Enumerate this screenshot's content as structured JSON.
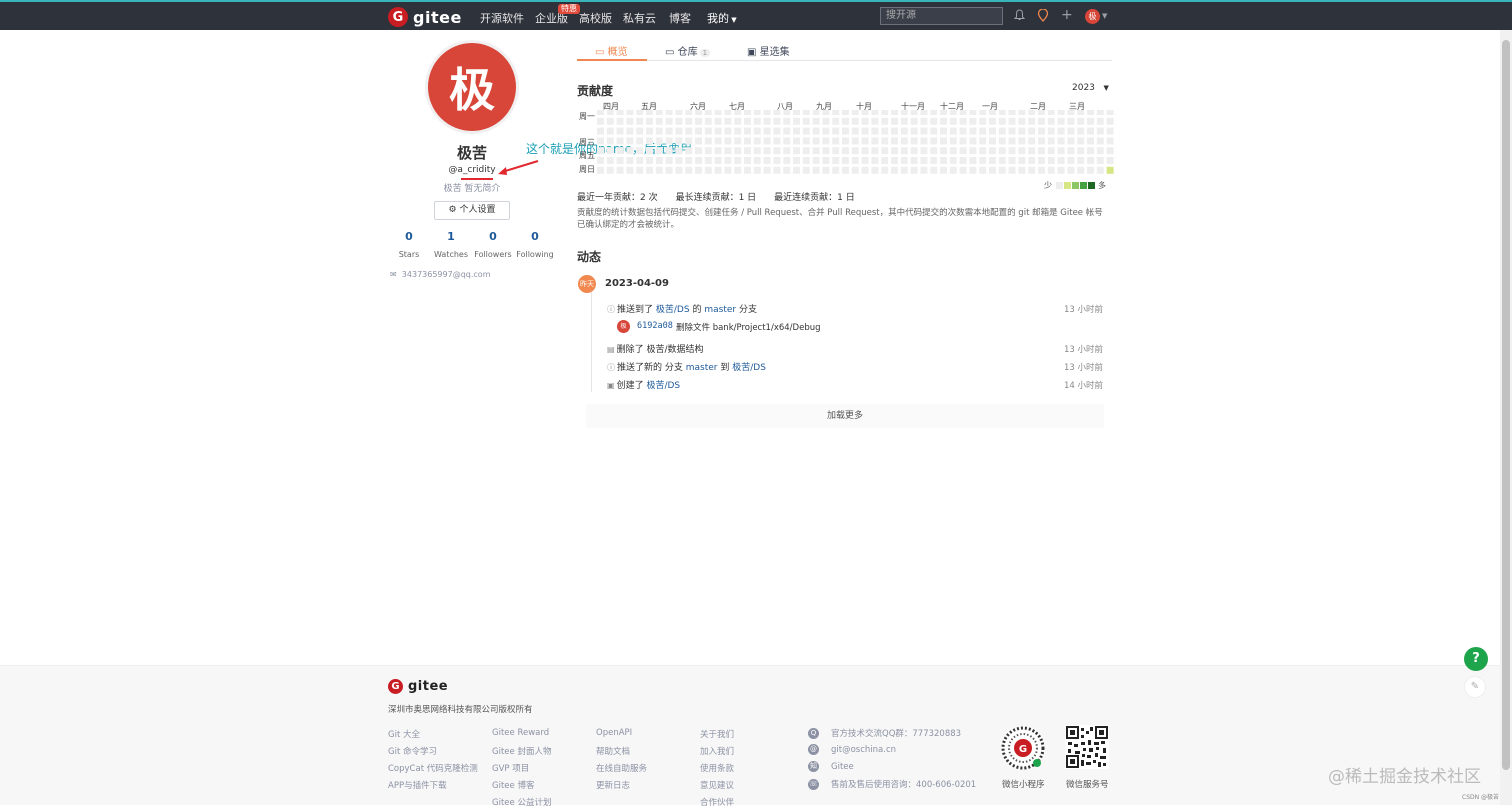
{
  "nav": {
    "brand": "gitee",
    "items": [
      "开源软件",
      "企业版",
      "高校版",
      "私有云",
      "博客",
      "我的"
    ],
    "badge": "特惠",
    "search_placeholder": "搜开源",
    "avatar_char": "极",
    "accent_color": "#37b5b9"
  },
  "profile": {
    "avatar_char": "极",
    "name": "极苦",
    "username": "@a_cridity",
    "bio": "极苦 暂无简介",
    "settings_label": "个人设置",
    "stats": [
      {
        "value": "0",
        "label": "Stars"
      },
      {
        "value": "1",
        "label": "Watches"
      },
      {
        "value": "0",
        "label": "Followers"
      },
      {
        "value": "0",
        "label": "Following"
      }
    ],
    "email": "3437365997@qq.com"
  },
  "annotation": "这个就是你的name，后面要用",
  "tabs": [
    {
      "label": "概览",
      "active": true
    },
    {
      "label": "仓库",
      "count": "1"
    },
    {
      "label": "星选集"
    }
  ],
  "contribution": {
    "title": "贡献度",
    "year": "2023",
    "months": [
      "四月",
      "五月",
      "六月",
      "七月",
      "八月",
      "九月",
      "十月",
      "十一月",
      "十二月",
      "一月",
      "二月",
      "三月"
    ],
    "days": [
      "周一",
      "周三",
      "周五",
      "周日"
    ],
    "legend_less": "少",
    "legend_more": "多",
    "stats": "最近一年贡献：2 次　　最长连续贡献：1 日　　最近连续贡献：1 日",
    "description": "贡献度的统计数据包括代码提交、创建任务 / Pull Request、合并 Pull Request，其中代码提交的次数需本地配置的 git 邮箱是 Gitee 帐号已确认绑定的才会被统计。",
    "level_colors": [
      "#eeeeee",
      "#d6e685",
      "#8cc665",
      "#44a340",
      "#1e6823"
    ]
  },
  "activity": {
    "title": "动态",
    "day_badge": "昨天",
    "date": "2023-04-09",
    "events": [
      {
        "icon": "push-icon",
        "pre": "推送到了",
        "link1": "极苦/DS",
        "mid": "的",
        "link2": "master",
        "post": "分支",
        "time": "13 小时前"
      },
      {
        "icon": "delete-icon",
        "pre": "删除了",
        "link1": "",
        "mid": "极苦/数据结构",
        "link2": "",
        "post": "",
        "time": "13 小时前"
      },
      {
        "icon": "push-icon",
        "pre": "推送了新的 分支",
        "link1": "master",
        "mid": "到",
        "link2": "极苦/DS",
        "post": "",
        "time": "13 小时前"
      },
      {
        "icon": "create-icon",
        "pre": "创建了",
        "link1": "极苦/DS",
        "mid": "",
        "link2": "",
        "post": "",
        "time": "14 小时前"
      }
    ],
    "commit": {
      "avatar_char": "极",
      "hash": "6192a08",
      "message": "删除文件 bank/Project1/x64/Debug"
    },
    "load_more": "加载更多"
  },
  "footer": {
    "brand": "gitee",
    "copyright": "深圳市奥思网络科技有限公司版权所有",
    "col1": [
      "Git 大全",
      "Git 命令学习",
      "CopyCat 代码克隆检测",
      "APP与插件下载"
    ],
    "col2": [
      "Gitee Reward",
      "Gitee 封面人物",
      "GVP 项目",
      "Gitee 博客",
      "Gitee 公益计划"
    ],
    "col3": [
      "OpenAPI",
      "帮助文档",
      "在线自助服务",
      "更新日志"
    ],
    "col4": [
      "关于我们",
      "加入我们",
      "使用条款",
      "意见建议",
      "合作伙伴"
    ],
    "contacts": [
      {
        "icon": "qq-icon",
        "text": "官方技术交流QQ群：777320883"
      },
      {
        "icon": "mail-icon",
        "text": "git@oschina.cn"
      },
      {
        "icon": "zhihu-icon",
        "text": "Gitee"
      },
      {
        "icon": "phone-icon",
        "text": "售前及售后使用咨询：400-606-0201"
      }
    ],
    "qr_labels": [
      "微信小程序",
      "微信服务号"
    ]
  },
  "help_label": "?",
  "watermark": "@稀土掘金技术社区",
  "csdn": "CSDN @极苦"
}
